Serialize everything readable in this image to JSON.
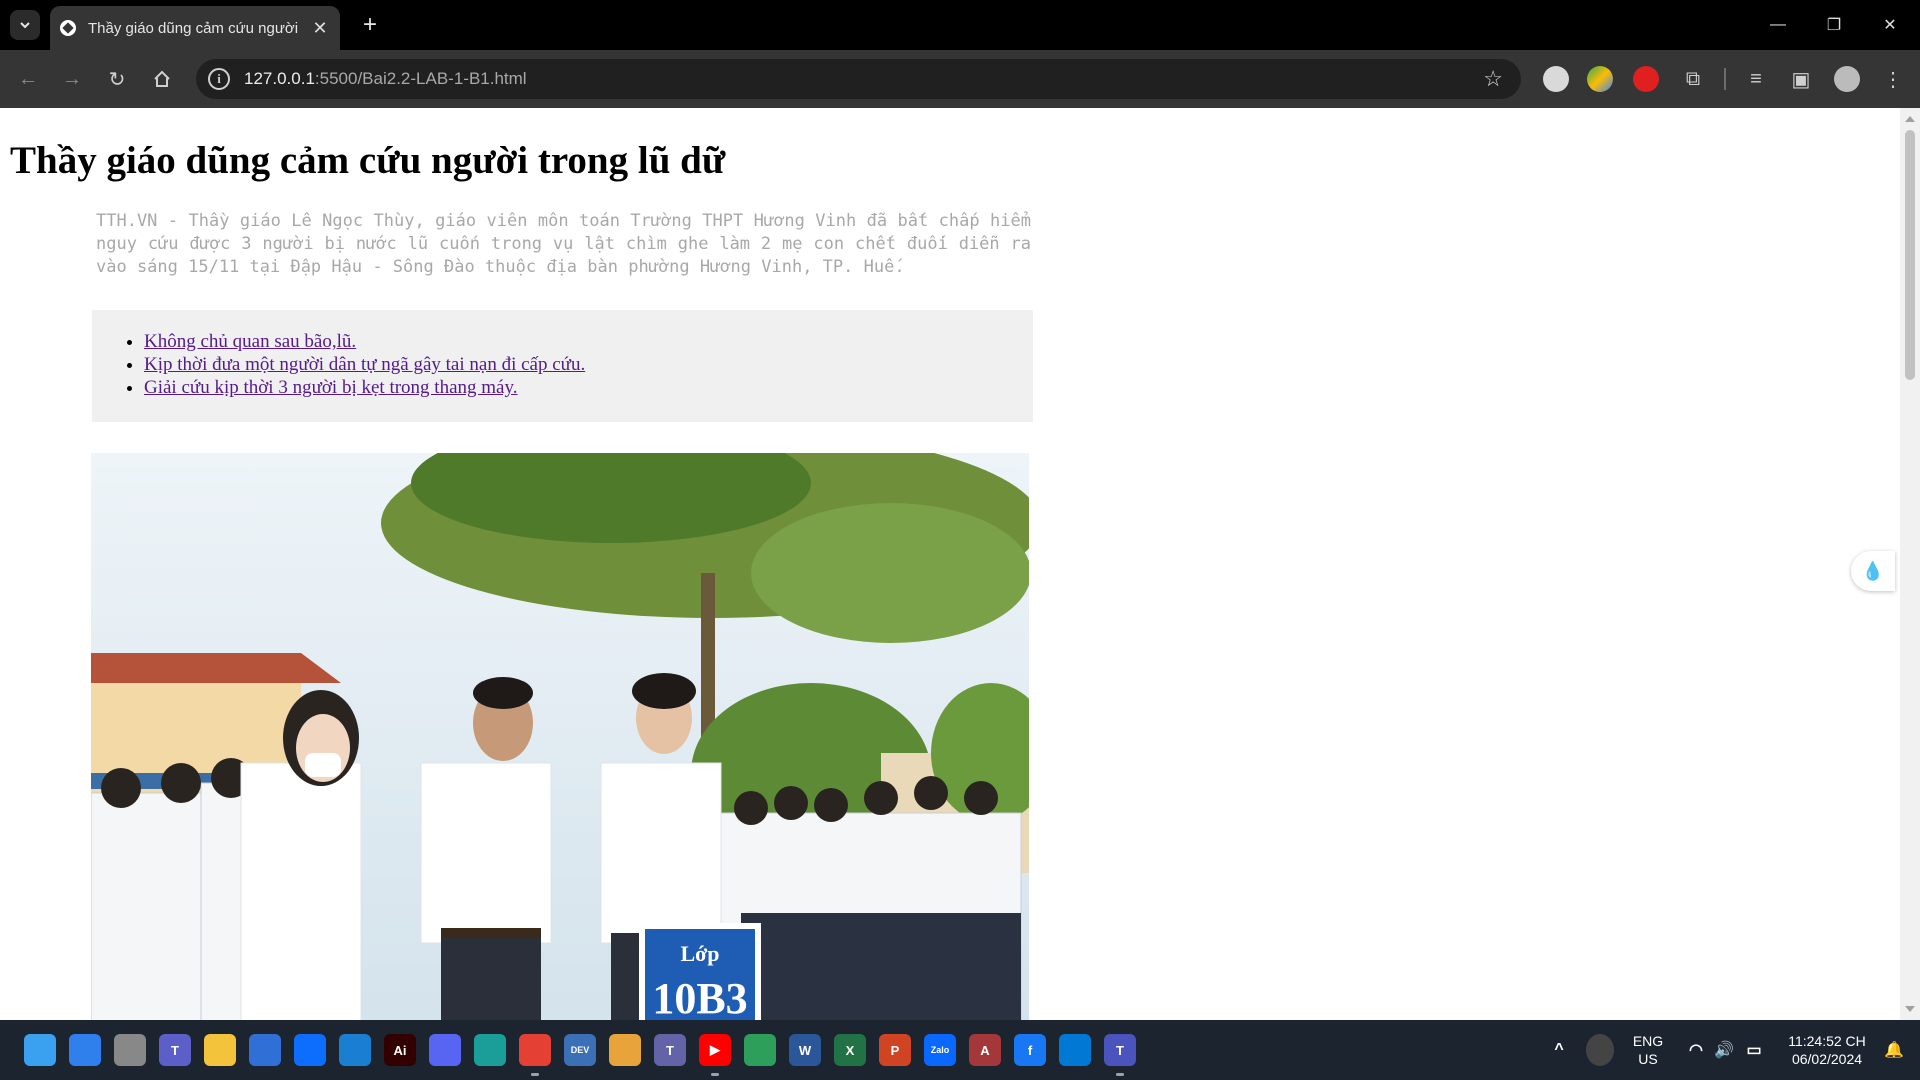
{
  "browser": {
    "tab_title": "Thầy giáo dũng cảm cứu người",
    "url_host": "127.0.0.1",
    "url_path": ":5500/Bai2.2-LAB-1-B1.html"
  },
  "article": {
    "headline": "Thầy giáo dũng cảm cứu người trong lũ dữ",
    "summary": "TTH.VN - Thầy giáo Lê Ngọc Thùy, giáo viên môn toán Trường THPT Hương Vinh đã bất chấp hiểm nguy cứu được 3 người bị nước lũ cuốn trong vụ lật chìm ghe làm 2 mẹ con chết đuối diễn ra vào sáng 15/11 tại Đập Hậu - Sông Đào thuộc địa bàn phường Hương Vinh, TP. Huế.",
    "related_links": [
      "Không chủ quan sau bão,lũ.",
      "Kịp thời đưa một người dân tự ngã gây tai nạn đi cấp cứu.",
      "Giải cứu kịp thời 3 người bị kẹt trong thang máy."
    ],
    "photo_sign": {
      "line1": "Lớp",
      "line2": "10B3"
    }
  },
  "taskbar": {
    "lang_top": "ENG",
    "lang_bottom": "US",
    "time": "11:24:52 CH",
    "date": "06/02/2024",
    "apps": [
      {
        "name": "start-button",
        "color": "#3aa0f0",
        "label": ""
      },
      {
        "name": "photoshop-pre-icon",
        "color": "#2f80ed",
        "label": ""
      },
      {
        "name": "task-view-icon",
        "color": "#888888",
        "label": ""
      },
      {
        "name": "teams-icon",
        "color": "#5b5fc7",
        "label": "T"
      },
      {
        "name": "file-explorer-icon",
        "color": "#f3c33c",
        "label": ""
      },
      {
        "name": "store-icon",
        "color": "#2f6fd6",
        "label": ""
      },
      {
        "name": "dropbox-icon",
        "color": "#0d6efd",
        "label": ""
      },
      {
        "name": "security-icon",
        "color": "#1a7fd0",
        "label": ""
      },
      {
        "name": "illustrator-icon",
        "color": "#330000",
        "label": "Ai"
      },
      {
        "name": "discord-icon",
        "color": "#5865f2",
        "label": ""
      },
      {
        "name": "edge-icon",
        "color": "#1b9e9a",
        "label": ""
      },
      {
        "name": "chrome-icon",
        "color": "#e44134",
        "label": ""
      },
      {
        "name": "devhome-icon",
        "color": "#3b6fb6",
        "label": "DEV"
      },
      {
        "name": "photos-icon",
        "color": "#e8a33b",
        "label": ""
      },
      {
        "name": "teams-classic-icon",
        "color": "#6264a7",
        "label": "T"
      },
      {
        "name": "youtube-icon",
        "color": "#ff0000",
        "label": "▶"
      },
      {
        "name": "git-icon",
        "color": "#2e9e5b",
        "label": ""
      },
      {
        "name": "word-icon",
        "color": "#2b579a",
        "label": "W"
      },
      {
        "name": "excel-icon",
        "color": "#217346",
        "label": "X"
      },
      {
        "name": "powerpoint-icon",
        "color": "#d04423",
        "label": "P"
      },
      {
        "name": "zalo-icon",
        "color": "#0a68fe",
        "label": "Zalo"
      },
      {
        "name": "access-icon",
        "color": "#a4373a",
        "label": "A"
      },
      {
        "name": "facebook-icon",
        "color": "#1877f2",
        "label": "f"
      },
      {
        "name": "vscode-icon",
        "color": "#0078d4",
        "label": ""
      },
      {
        "name": "teams-new-icon",
        "color": "#4b53bc",
        "label": "T"
      }
    ]
  }
}
